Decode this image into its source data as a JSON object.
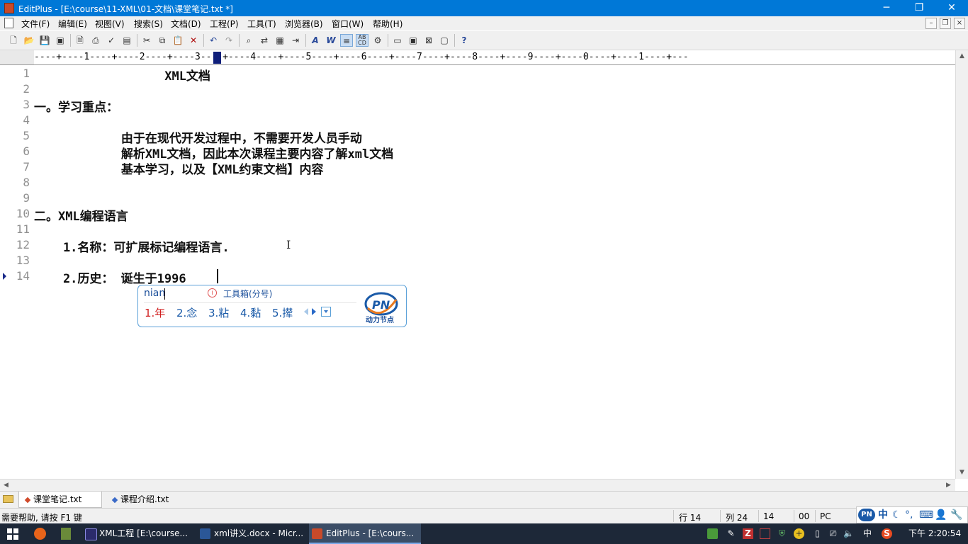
{
  "window": {
    "title": "EditPlus - [E:\\course\\11-XML\\01-文档\\课堂笔记.txt *]",
    "controls": {
      "minimize": "─",
      "maximize": "❐",
      "close": "✕"
    }
  },
  "menu": [
    "文件(F)",
    "编辑(E)",
    "视图(V)",
    "搜索(S)",
    "文档(D)",
    "工程(P)",
    "工具(T)",
    "浏览器(B)",
    "窗口(W)",
    "帮助(H)"
  ],
  "toolbar": {
    "icons": [
      "new-file-icon",
      "open-folder-icon",
      "save-icon",
      "save-all-icon",
      "print-preview-icon",
      "print-icon",
      "spell-check-icon",
      "clipboard-history-icon",
      "cut-icon",
      "copy-icon",
      "paste-icon",
      "delete-icon",
      "undo-icon",
      "redo-icon",
      "find-icon",
      "replace-icon",
      "find-in-files-icon",
      "goto-line-icon",
      "font-icon",
      "word-wrap-icon",
      "line-number-icon",
      "column-select-icon",
      "settings-icon",
      "window-1-icon",
      "window-2-icon",
      "window-3-icon",
      "window-4-icon",
      "help-context-icon"
    ]
  },
  "ruler": {
    "text": "----+----1----+----2----+----3----+----4----+----5----+----6----+----7----+----8----+----9----+----0----+----1----+---"
  },
  "editor": {
    "lines": [
      {
        "num": "1",
        "text": "                  XML文档"
      },
      {
        "num": "2",
        "text": ""
      },
      {
        "num": "3",
        "text": "一。学习重点："
      },
      {
        "num": "4",
        "text": ""
      },
      {
        "num": "5",
        "text": "            由于在现代开发过程中，不需要开发人员手动"
      },
      {
        "num": "6",
        "text": "            解析XML文档，因此本次课程主要内容了解xml文档"
      },
      {
        "num": "7",
        "text": "            基本学习，以及【XML约束文档】内容"
      },
      {
        "num": "8",
        "text": ""
      },
      {
        "num": "9",
        "text": ""
      },
      {
        "num": "10",
        "text": "二。XML编程语言"
      },
      {
        "num": "11",
        "text": ""
      },
      {
        "num": "12",
        "text": "    1.名称：可扩展标记编程语言."
      },
      {
        "num": "13",
        "text": ""
      },
      {
        "num": "14",
        "text": "    2.历史： 诞生于1996"
      }
    ],
    "current_line": 14
  },
  "ime": {
    "pinyin": "nian",
    "hint": "工具箱(分号)",
    "candidates": [
      "1.年",
      "2.念",
      "3.粘",
      "4.黏",
      "5.撵"
    ],
    "brand": "动力节点"
  },
  "tabs": [
    {
      "label": "课堂笔记.txt",
      "active": true,
      "dot_color": "#d04a2a"
    },
    {
      "label": "课程介绍.txt",
      "active": false,
      "dot_color": "#3a6ac8"
    }
  ],
  "status": {
    "help": "需要帮助, 请按 F1 键",
    "row": "行 14",
    "col": "列 24",
    "count": "14",
    "code": "00",
    "mode": "PC"
  },
  "ime_toolbar": {
    "mode": "中",
    "items": [
      "moon-icon",
      "punct-icon",
      "keyboard-icon",
      "user-icon",
      "tools-icon"
    ]
  },
  "taskbar": {
    "tasks": [
      {
        "label": "XML工程 [E:\\course...",
        "active": false,
        "color": "#2b2b6b"
      },
      {
        "label": "xml讲义.docx - Micr...",
        "active": false,
        "color": "#2b5797"
      },
      {
        "label": "EditPlus - [E:\\cours...",
        "active": true,
        "color": "#c84a2a"
      }
    ],
    "ime": "中",
    "clock": "下午 2:20:54"
  },
  "colors": {
    "titlebar": "#0078d7",
    "taskbar": "#1d2838",
    "ime_border": "#5aa0d8",
    "candidate_first": "#d02020"
  }
}
